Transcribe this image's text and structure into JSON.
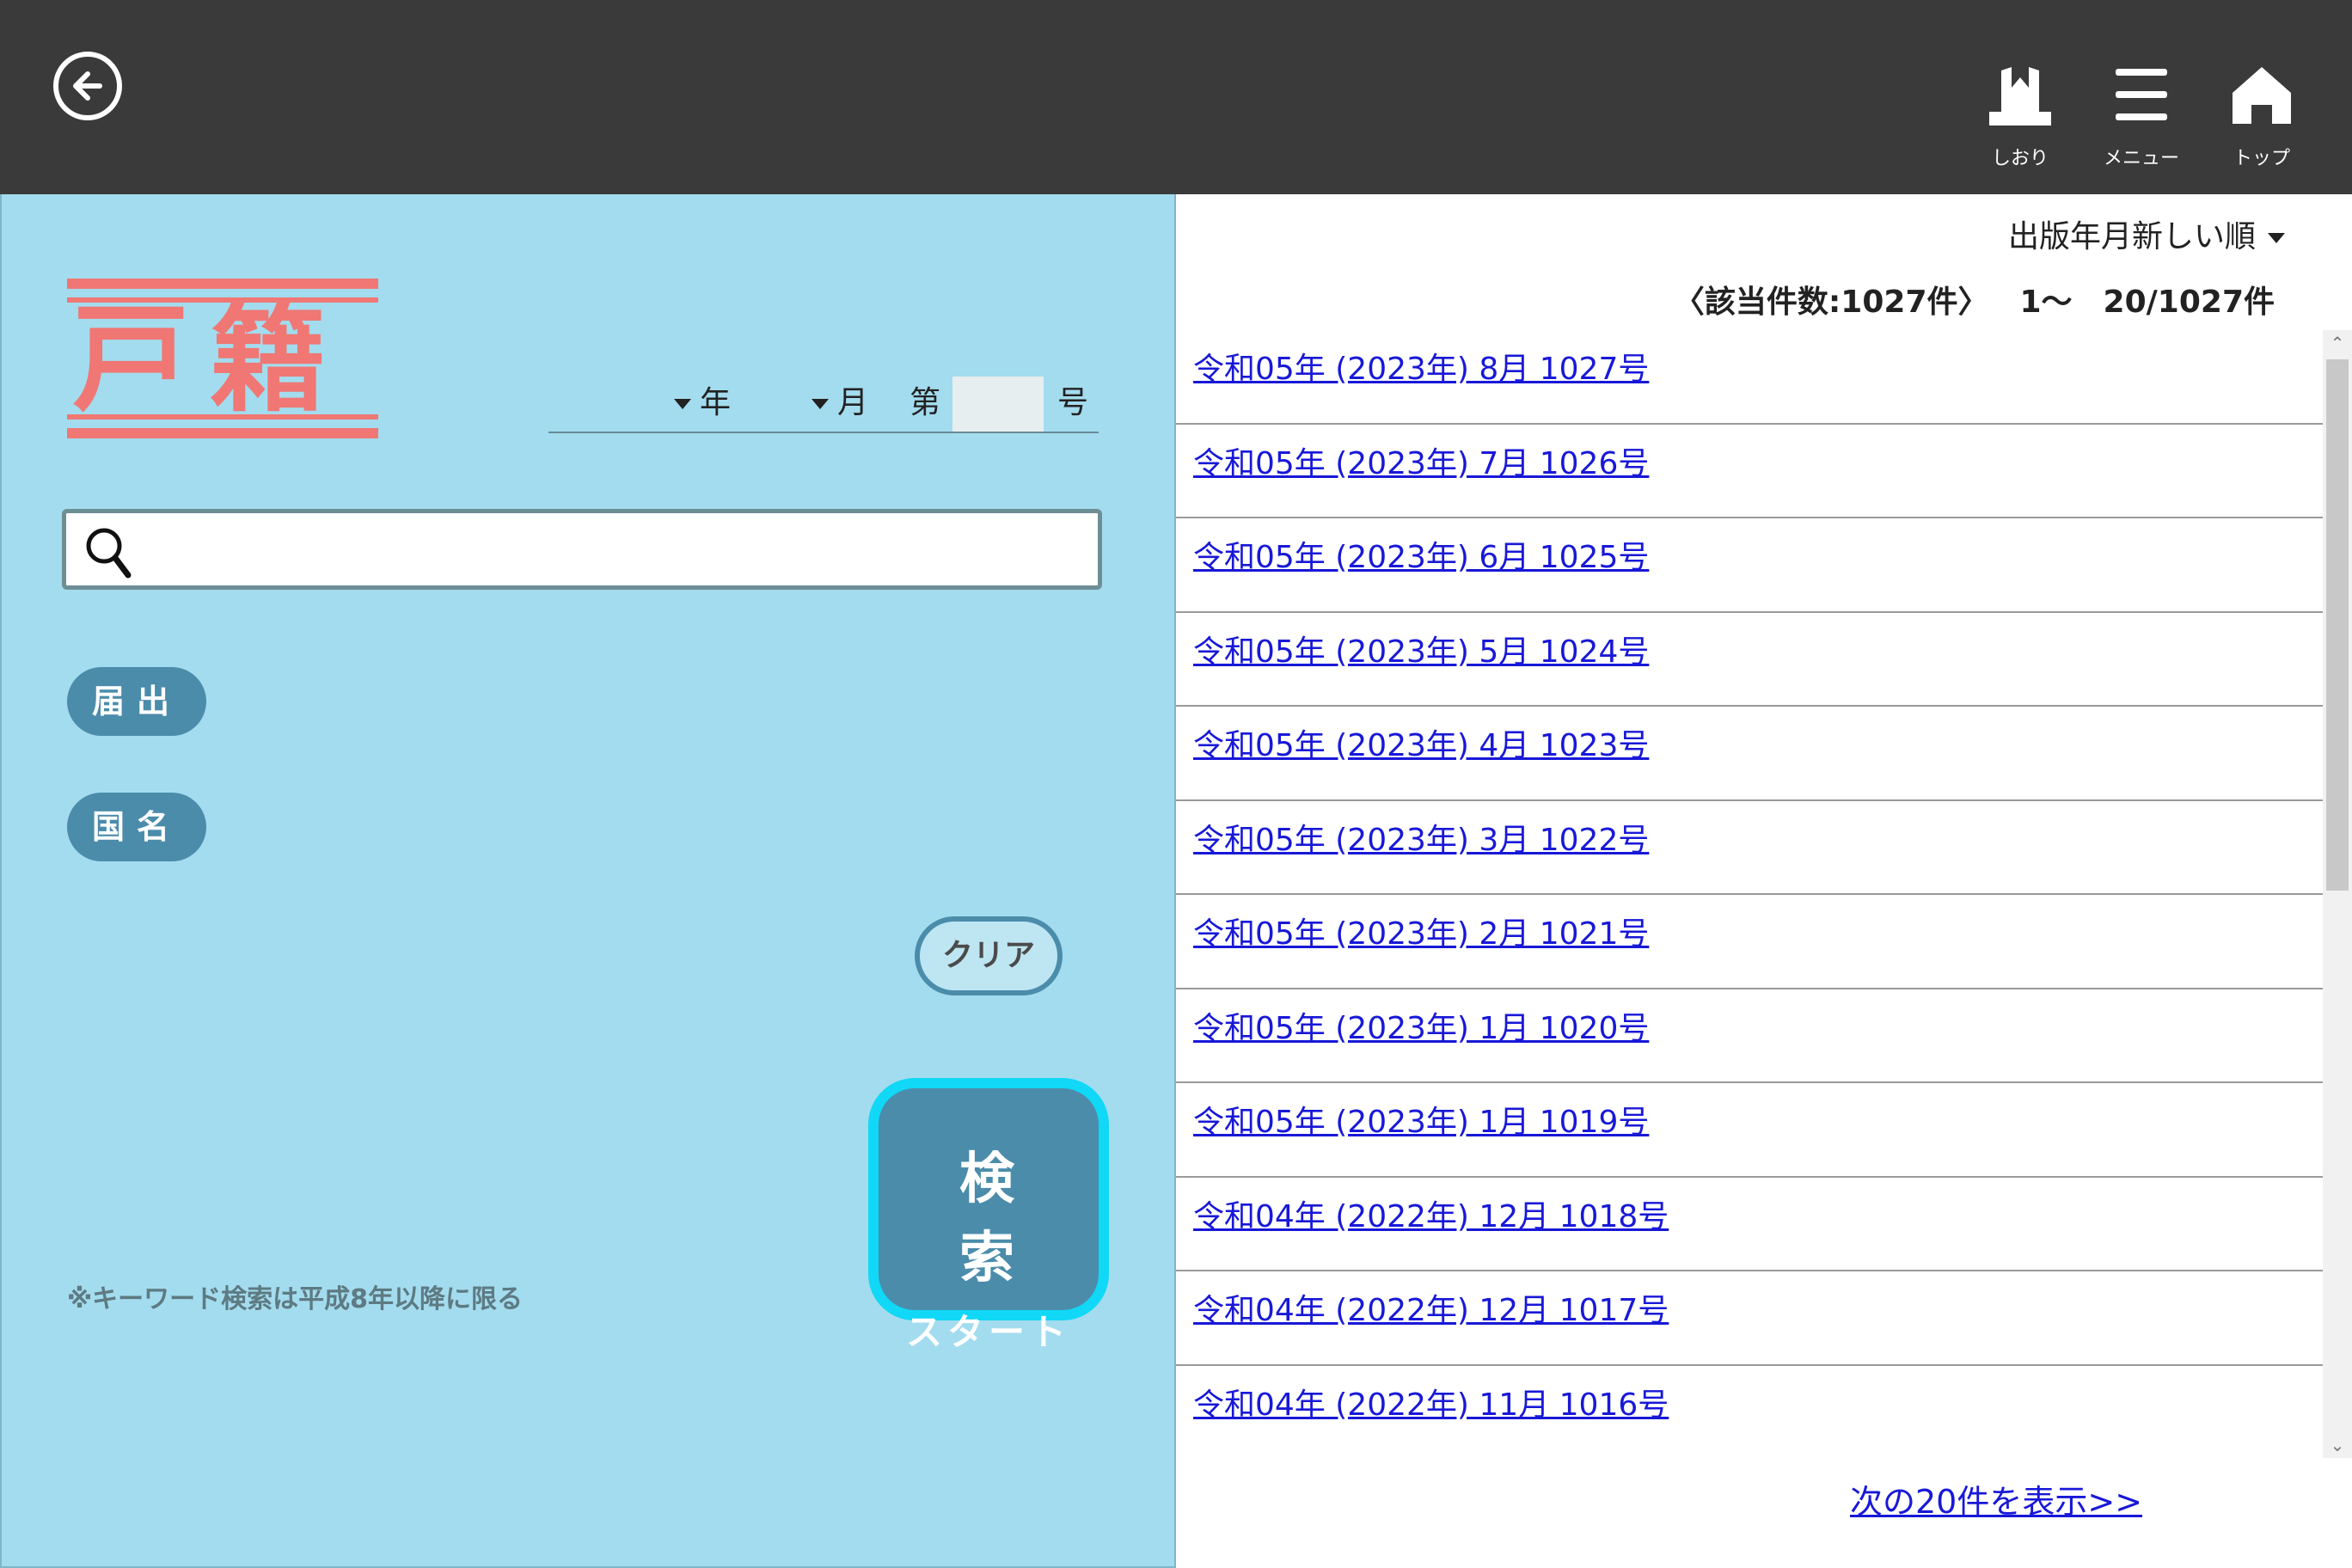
{
  "header": {
    "back_icon": "arrow-left-circle-icon",
    "buttons": [
      {
        "label": "しおり",
        "icon": "bookmark-icon"
      },
      {
        "label": "メニュー",
        "icon": "hamburger-menu-icon"
      },
      {
        "label": "トップ",
        "icon": "home-icon"
      }
    ]
  },
  "search": {
    "title": "戸籍",
    "title_color": "#f07774",
    "year_label": "年",
    "month_label": "月",
    "dai_label": "第",
    "issue_value": "",
    "go_label": "号",
    "keyword_value": "",
    "categories": [
      "届出",
      "国名"
    ],
    "clear_label": "クリア",
    "start_main": "検 索",
    "start_sub": "スタート",
    "note": "※キーワード検索は平成8年以降に限る"
  },
  "results": {
    "sort_label": "出版年月新しい順",
    "count_text": "〈該当件数:1027件〉",
    "range_text": "1〜　20/1027件",
    "items": [
      "令和05年 (2023年) 8月 1027号",
      "令和05年 (2023年) 7月 1026号",
      "令和05年 (2023年) 6月 1025号",
      "令和05年 (2023年) 5月 1024号",
      "令和05年 (2023年) 4月 1023号",
      "令和05年 (2023年) 3月 1022号",
      "令和05年 (2023年) 2月 1021号",
      "令和05年 (2023年) 1月 1020号",
      "令和05年 (2023年) 1月 1019号",
      "令和04年 (2022年) 12月 1018号",
      "令和04年 (2022年) 12月 1017号",
      "令和04年 (2022年) 11月 1016号"
    ],
    "next_label": "次の20件を表示>>"
  },
  "colors": {
    "header_bg": "#3a3a3a",
    "panel_bg": "#a3dcee",
    "accent": "#4b8cab",
    "start_border": "#10d8f6",
    "link": "#1818d8"
  }
}
